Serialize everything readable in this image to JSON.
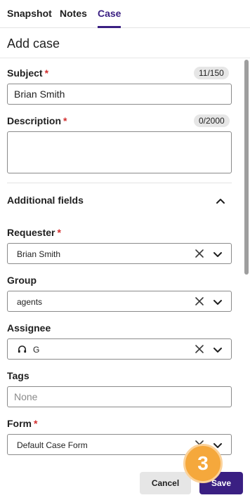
{
  "tabs": [
    {
      "label": "Snapshot"
    },
    {
      "label": "Notes"
    },
    {
      "label": "Case"
    }
  ],
  "page_title": "Add case",
  "subject": {
    "label": "Subject",
    "required_mark": "*",
    "counter": "11/150",
    "value": "Brian Smith"
  },
  "description": {
    "label": "Description",
    "required_mark": "*",
    "counter": "0/2000",
    "value": ""
  },
  "additional_fields": {
    "label": "Additional fields",
    "expanded": true,
    "icon": "chevron-up-icon"
  },
  "requester": {
    "label": "Requester",
    "required_mark": "*",
    "value": "Brian Smith"
  },
  "group": {
    "label": "Group",
    "value": "agents"
  },
  "assignee": {
    "label": "Assignee",
    "value": "G",
    "icon": "headset-icon"
  },
  "tags": {
    "label": "Tags",
    "placeholder": "None"
  },
  "form": {
    "label": "Form",
    "required_mark": "*",
    "value": "Default Case Form"
  },
  "footer": {
    "cancel_label": "Cancel",
    "save_label": "Save"
  },
  "step_badge": "3",
  "colors": {
    "accent": "#3a1f82",
    "required": "#d32f2f",
    "badge": "#f5a83c",
    "border": "#8a8a8a"
  }
}
